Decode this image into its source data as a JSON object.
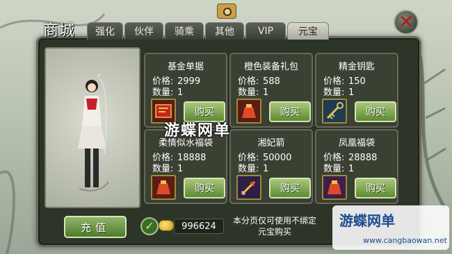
{
  "header": {
    "title": "商城",
    "close_label": "✕"
  },
  "tabs": [
    {
      "label": "强化",
      "active": false
    },
    {
      "label": "伙伴",
      "active": false
    },
    {
      "label": "骑乘",
      "active": false
    },
    {
      "label": "其他",
      "active": false
    },
    {
      "label": "VIP",
      "active": false
    },
    {
      "label": "元宝",
      "active": true
    }
  ],
  "labels": {
    "price": "价格:",
    "quantity": "数量:",
    "buy": "购买"
  },
  "items": [
    {
      "name": "基金单据",
      "price": "2999",
      "quantity": "1",
      "icon": "document-icon",
      "color": "#c7231e"
    },
    {
      "name": "橙色装备礼包",
      "price": "588",
      "quantity": "1",
      "icon": "bag-icon",
      "color": "#b23020"
    },
    {
      "name": "精金钥匙",
      "price": "150",
      "quantity": "1",
      "icon": "key-icon",
      "color": "#2a6e8a"
    },
    {
      "name": "柔情似水福袋",
      "price": "18888",
      "quantity": "1",
      "icon": "bag-icon",
      "color": "#b23020"
    },
    {
      "name": "湘妃箭",
      "price": "50000",
      "quantity": "1",
      "icon": "arrow-icon",
      "color": "#6a3a9a"
    },
    {
      "name": "凤凰福袋",
      "price": "28888",
      "quantity": "1",
      "icon": "bag-icon",
      "color": "#b23020"
    }
  ],
  "footer": {
    "recharge_label": "充值",
    "balance": "996624",
    "notice": "本分页仅可使用不绑定元宝购买"
  },
  "watermark": {
    "text": "游蝶网单",
    "logo_text": "游蝶网单",
    "logo_url": "www.cangbaowan.net"
  }
}
